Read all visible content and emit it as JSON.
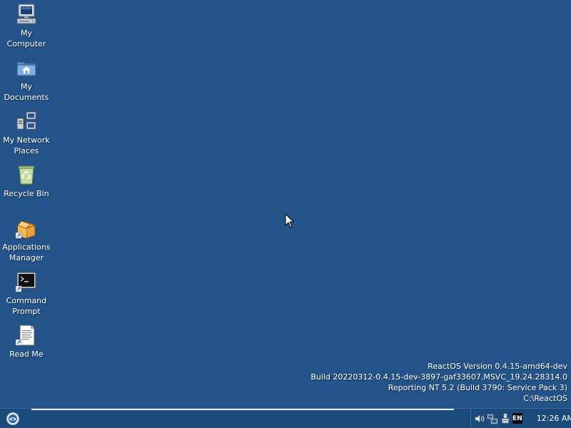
{
  "desktop": {
    "background_color": "#235389",
    "icons": [
      {
        "label": "My\nComputer",
        "icon": "computer-icon"
      },
      {
        "label": "My\nDocuments",
        "icon": "folder-documents-icon"
      },
      {
        "label": "My Network\nPlaces",
        "icon": "network-places-icon"
      },
      {
        "label": "Recycle Bin",
        "icon": "recycle-bin-icon"
      },
      {
        "label": "Applications\nManager",
        "icon": "applications-manager-icon"
      },
      {
        "label": "Command\nPrompt",
        "icon": "command-prompt-icon"
      },
      {
        "label": "Read Me",
        "icon": "text-document-icon"
      }
    ]
  },
  "version_info": {
    "line1": "ReactOS Version 0.4.15-amd64-dev",
    "line2": "Build 20220312-0.4.15-dev-3897-gaf33607.MSVC_19.24.28314.0",
    "line3": "Reporting NT 5.2 (Build 3790: Service Pack 3)",
    "line4": "C:\\ReactOS"
  },
  "taskbar": {
    "start_icon": "reactos-logo-icon",
    "tray": {
      "icons": [
        "volume-icon",
        "network-icon",
        "safely-remove-hardware-icon"
      ],
      "language": "EN",
      "clock": "12:26 AM"
    }
  }
}
